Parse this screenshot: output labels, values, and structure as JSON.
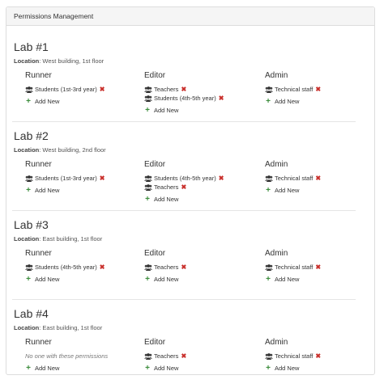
{
  "panel": {
    "title": "Permissions Management"
  },
  "location_label": "Location",
  "add_new_label": "Add New",
  "remove_glyph": "✖",
  "plus_glyph": "+",
  "colors": {
    "remove": "#c9302c",
    "add": "#3c8d3c",
    "heading_bg": "#f5f5f5"
  },
  "labs": [
    {
      "name": "Lab #1",
      "location": "West building, 1st floor",
      "columns": [
        {
          "title": "Runner",
          "groups": [
            "Students (1st-3rd year)"
          ]
        },
        {
          "title": "Editor",
          "groups": [
            "Teachers",
            "Students (4th-5th year)"
          ]
        },
        {
          "title": "Admin",
          "groups": [
            "Technical staff"
          ]
        }
      ]
    },
    {
      "name": "Lab #2",
      "location": "West building, 2nd floor",
      "columns": [
        {
          "title": "Runner",
          "groups": [
            "Students (1st-3rd year)"
          ]
        },
        {
          "title": "Editor",
          "groups": [
            "Students (4th-5th year)",
            "Teachers"
          ]
        },
        {
          "title": "Admin",
          "groups": [
            "Technical staff"
          ]
        }
      ]
    },
    {
      "name": "Lab #3",
      "location": "East building, 1st floor",
      "columns": [
        {
          "title": "Runner",
          "groups": [
            "Students (4th-5th year)"
          ]
        },
        {
          "title": "Editor",
          "groups": [
            "Teachers"
          ]
        },
        {
          "title": "Admin",
          "groups": [
            "Technical staff"
          ]
        }
      ]
    },
    {
      "name": "Lab #4",
      "location": "East building, 1st floor",
      "columns": [
        {
          "title": "Runner",
          "groups": [],
          "empty_text": "No one with these permissions"
        },
        {
          "title": "Editor",
          "groups": [
            "Teachers"
          ]
        },
        {
          "title": "Admin",
          "groups": [
            "Technical staff"
          ]
        }
      ]
    }
  ]
}
